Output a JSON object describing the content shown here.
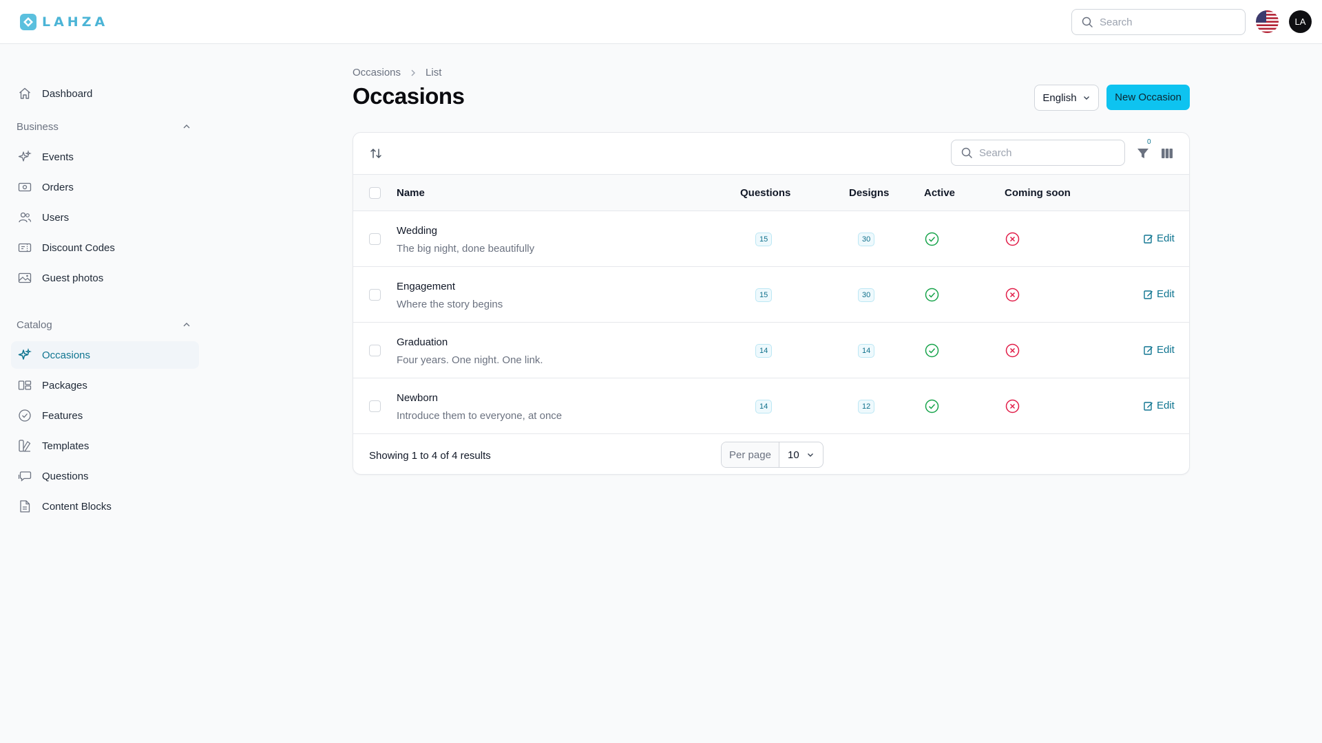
{
  "app": {
    "name": "LAHZA",
    "accent": "#0ec3f0"
  },
  "header": {
    "search_placeholder": "Search",
    "language_flag_icon": "us-flag-icon",
    "user_initials": "LA"
  },
  "sidebar": {
    "dashboard": {
      "label": "Dashboard",
      "icon": "home-icon"
    },
    "groups": [
      {
        "label": "Business",
        "items": [
          {
            "label": "Events",
            "icon": "sparkles-icon"
          },
          {
            "label": "Orders",
            "icon": "banknote-icon"
          },
          {
            "label": "Users",
            "icon": "users-icon"
          },
          {
            "label": "Discount Codes",
            "icon": "ticket-icon"
          },
          {
            "label": "Guest photos",
            "icon": "photo-icon"
          }
        ]
      },
      {
        "label": "Catalog",
        "items": [
          {
            "label": "Occasions",
            "icon": "sparkles-icon",
            "active": true
          },
          {
            "label": "Packages",
            "icon": "layout-icon"
          },
          {
            "label": "Features",
            "icon": "check-badge-icon"
          },
          {
            "label": "Templates",
            "icon": "swatch-icon"
          },
          {
            "label": "Questions",
            "icon": "chat-icon"
          },
          {
            "label": "Content Blocks",
            "icon": "document-icon"
          }
        ]
      }
    ]
  },
  "page": {
    "breadcrumb": [
      "Occasions",
      "List"
    ],
    "title": "Occasions",
    "language_select": "English",
    "new_button": "New Occasion"
  },
  "table": {
    "search_placeholder": "Search",
    "filter_count": "0",
    "columns": [
      "Name",
      "Questions",
      "Designs",
      "Active",
      "Coming soon"
    ],
    "rows": [
      {
        "name": "Wedding",
        "description": "The big night, done beautifully",
        "questions": "15",
        "designs": "30",
        "active": true,
        "coming_soon": false,
        "action": "Edit"
      },
      {
        "name": "Engagement",
        "description": "Where the story begins",
        "questions": "15",
        "designs": "30",
        "active": true,
        "coming_soon": false,
        "action": "Edit"
      },
      {
        "name": "Graduation",
        "description": "Four years. One night. One link.",
        "questions": "14",
        "designs": "14",
        "active": true,
        "coming_soon": false,
        "action": "Edit"
      },
      {
        "name": "Newborn",
        "description": "Introduce them to everyone, at once",
        "questions": "14",
        "designs": "12",
        "active": true,
        "coming_soon": false,
        "action": "Edit"
      }
    ],
    "footer": {
      "summary": "Showing 1 to 4 of 4 results",
      "per_page_label": "Per page",
      "per_page_value": "10"
    }
  },
  "colors": {
    "active_green": "#16a34a",
    "inactive_red": "#e11d48",
    "link": "#0e7490"
  }
}
